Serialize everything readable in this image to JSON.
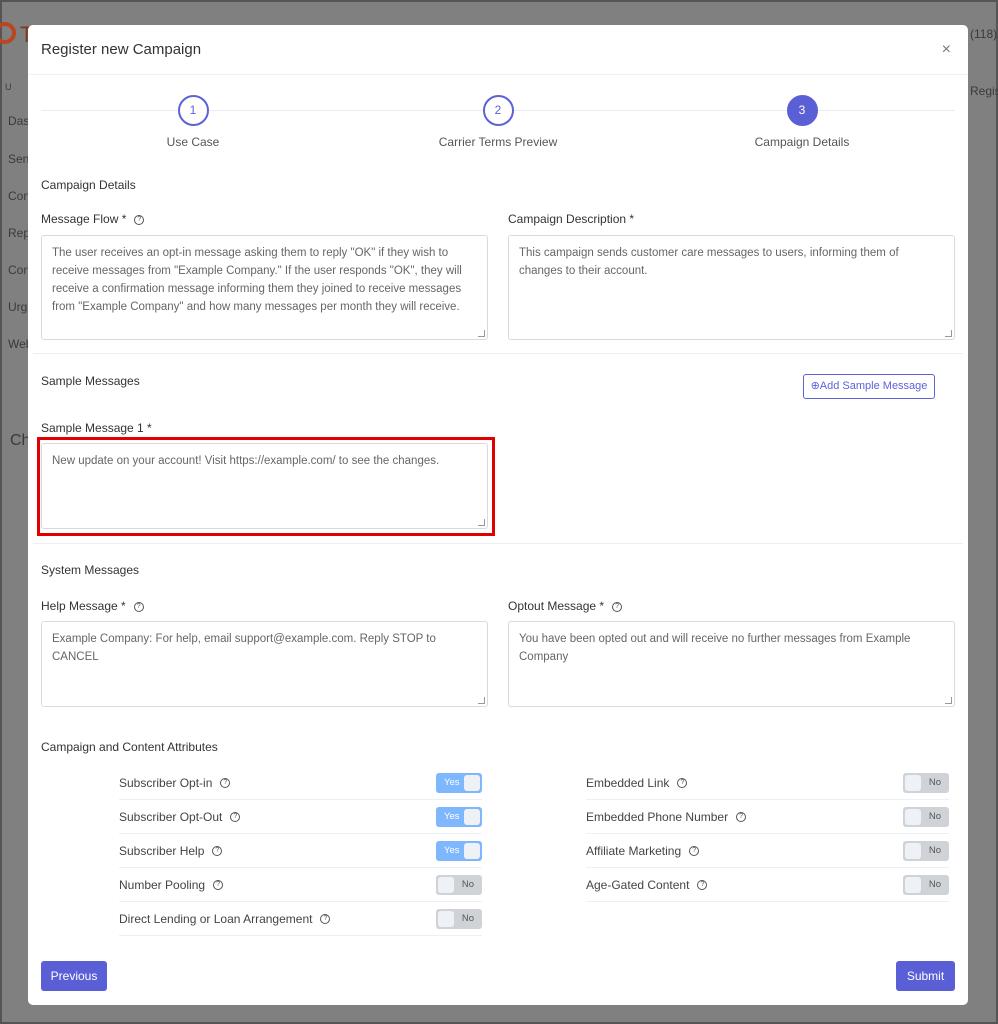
{
  "background": {
    "fragments": [
      "T",
      "(118)",
      "U",
      "Regis",
      "Das",
      "Sen",
      "Con",
      "Rep",
      "Con",
      "Urg",
      "Web",
      "Ch"
    ]
  },
  "modal": {
    "title": "Register new Campaign",
    "close_label": "×"
  },
  "steps": [
    {
      "num": "1",
      "label": "Use Case"
    },
    {
      "num": "2",
      "label": "Carrier Terms Preview"
    },
    {
      "num": "3",
      "label": "Campaign Details",
      "active": true
    }
  ],
  "campaign": {
    "section": "Campaign Details",
    "message_flow_label": "Message Flow *",
    "message_flow": "The user receives an opt-in message asking them to reply \"OK\" if they wish to receive messages from \"Example Company.\" If the user responds \"OK\", they will receive a confirmation message informing them they joined to receive messages from \"Example Company\" and how many messages per month they will receive.",
    "description_label": "Campaign Description *",
    "description": "This campaign sends customer care messages to users, informing them of changes to their account."
  },
  "samples": {
    "section": "Sample Messages",
    "add_label": "⊕Add Sample Message",
    "label1": "Sample Message 1 *",
    "value1": "New update on your account! Visit https://example.com/ to see the changes."
  },
  "system": {
    "section": "System Messages",
    "help_label": "Help Message *",
    "help_value": "Example Company: For help, email support@example.com. Reply STOP to CANCEL",
    "optout_label": "Optout Message *",
    "optout_value": "You have been opted out and will receive no further messages from Example Company"
  },
  "attributes": {
    "section": "Campaign and Content Attributes",
    "left": [
      {
        "label": "Subscriber Opt-in",
        "value": "Yes"
      },
      {
        "label": "Subscriber Opt-Out",
        "value": "Yes"
      },
      {
        "label": "Subscriber Help",
        "value": "Yes"
      },
      {
        "label": "Number Pooling",
        "value": "No"
      },
      {
        "label": "Direct Lending or Loan Arrangement",
        "value": "No"
      }
    ],
    "right": [
      {
        "label": "Embedded Link",
        "value": "No"
      },
      {
        "label": "Embedded Phone Number",
        "value": "No"
      },
      {
        "label": "Affiliate Marketing",
        "value": "No"
      },
      {
        "label": "Age-Gated Content",
        "value": "No"
      }
    ]
  },
  "footer": {
    "previous": "Previous",
    "submit": "Submit"
  },
  "colors": {
    "accent": "#5b5fd6",
    "toggle_on": "#7fb7ff",
    "highlight": "#e00000"
  }
}
